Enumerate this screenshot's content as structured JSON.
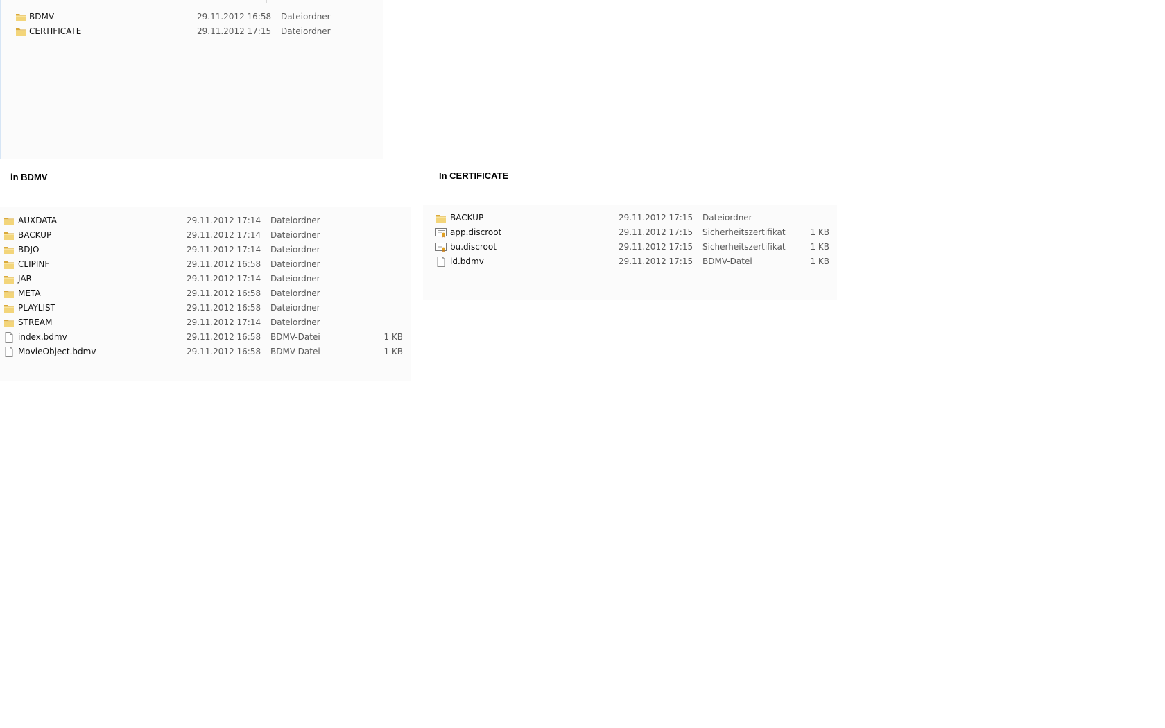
{
  "panels": {
    "root": {
      "rows": [
        {
          "name": "BDMV",
          "date": "29.11.2012 16:58",
          "type": "Dateiordner",
          "size": "",
          "icon": "folder-icon"
        },
        {
          "name": "CERTIFICATE",
          "date": "29.11.2012 17:15",
          "type": "Dateiordner",
          "size": "",
          "icon": "folder-icon"
        }
      ]
    },
    "bdmv": {
      "heading": "in BDMV",
      "rows": [
        {
          "name": "AUXDATA",
          "date": "29.11.2012 17:14",
          "type": "Dateiordner",
          "size": "",
          "icon": "folder-icon"
        },
        {
          "name": "BACKUP",
          "date": "29.11.2012 17:14",
          "type": "Dateiordner",
          "size": "",
          "icon": "folder-icon"
        },
        {
          "name": "BDJO",
          "date": "29.11.2012 17:14",
          "type": "Dateiordner",
          "size": "",
          "icon": "folder-icon"
        },
        {
          "name": "CLIPINF",
          "date": "29.11.2012 16:58",
          "type": "Dateiordner",
          "size": "",
          "icon": "folder-icon"
        },
        {
          "name": "JAR",
          "date": "29.11.2012 17:14",
          "type": "Dateiordner",
          "size": "",
          "icon": "folder-icon"
        },
        {
          "name": "META",
          "date": "29.11.2012 16:58",
          "type": "Dateiordner",
          "size": "",
          "icon": "folder-icon"
        },
        {
          "name": "PLAYLIST",
          "date": "29.11.2012 16:58",
          "type": "Dateiordner",
          "size": "",
          "icon": "folder-icon"
        },
        {
          "name": "STREAM",
          "date": "29.11.2012 17:14",
          "type": "Dateiordner",
          "size": "",
          "icon": "folder-icon"
        },
        {
          "name": "index.bdmv",
          "date": "29.11.2012 16:58",
          "type": "BDMV-Datei",
          "size": "1 KB",
          "icon": "file-icon"
        },
        {
          "name": "MovieObject.bdmv",
          "date": "29.11.2012 16:58",
          "type": "BDMV-Datei",
          "size": "1 KB",
          "icon": "file-icon"
        }
      ]
    },
    "certificate": {
      "heading": "In CERTIFICATE",
      "rows": [
        {
          "name": "BACKUP",
          "date": "29.11.2012 17:15",
          "type": "Dateiordner",
          "size": "",
          "icon": "folder-icon"
        },
        {
          "name": "app.discroot",
          "date": "29.11.2012 17:15",
          "type": "Sicherheitszertifikat",
          "size": "1 KB",
          "icon": "certificate-icon"
        },
        {
          "name": "bu.discroot",
          "date": "29.11.2012 17:15",
          "type": "Sicherheitszertifikat",
          "size": "1 KB",
          "icon": "certificate-icon"
        },
        {
          "name": "id.bdmv",
          "date": "29.11.2012 17:15",
          "type": "BDMV-Datei",
          "size": "1 KB",
          "icon": "file-icon"
        }
      ]
    }
  },
  "colors": {
    "folder": "#e8c25a",
    "panel_bg": "#fbfbfb"
  }
}
